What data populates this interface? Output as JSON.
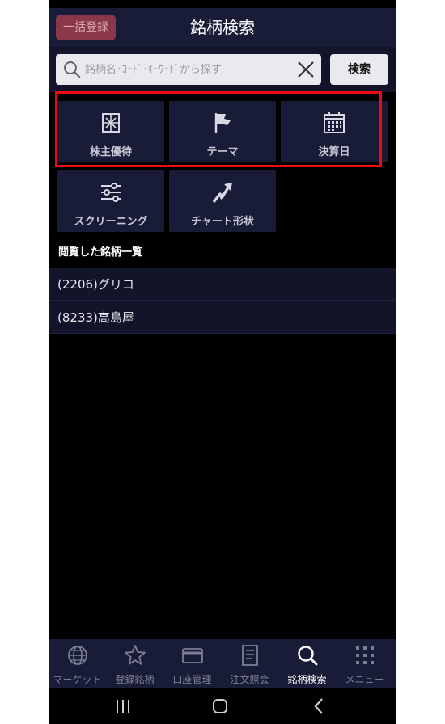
{
  "header": {
    "bulk_register_label": "一括登録",
    "title": "銘柄検索"
  },
  "search": {
    "placeholder": "銘柄名･ｺｰﾄﾞ･ｷｰﾜｰﾄﾞから探す",
    "value": "",
    "button_label": "検索"
  },
  "categories": [
    {
      "label": "株主優待",
      "icon": "gift-icon"
    },
    {
      "label": "テーマ",
      "icon": "flag-icon"
    },
    {
      "label": "決算日",
      "icon": "calendar-icon"
    },
    {
      "label": "スクリーニング",
      "icon": "sliders-icon"
    },
    {
      "label": "チャート形状",
      "icon": "trend-arrow-icon"
    }
  ],
  "recent": {
    "heading": "閲覧した銘柄一覧",
    "items": [
      "(2206)グリコ",
      "(8233)高島屋"
    ]
  },
  "tabbar": {
    "active": "銘柄検索",
    "items": [
      {
        "label": "マーケット",
        "icon": "globe-icon"
      },
      {
        "label": "登録銘柄",
        "icon": "star-icon"
      },
      {
        "label": "口座管理",
        "icon": "card-icon"
      },
      {
        "label": "注文照会",
        "icon": "document-icon"
      },
      {
        "label": "銘柄検索",
        "icon": "search-icon"
      },
      {
        "label": "メニュー",
        "icon": "grid-icon"
      }
    ]
  },
  "colors": {
    "header_bg": "#191c36",
    "tile_bg": "#191c36",
    "highlight": "#ee0a10",
    "bulk_button": "#8a3848"
  }
}
